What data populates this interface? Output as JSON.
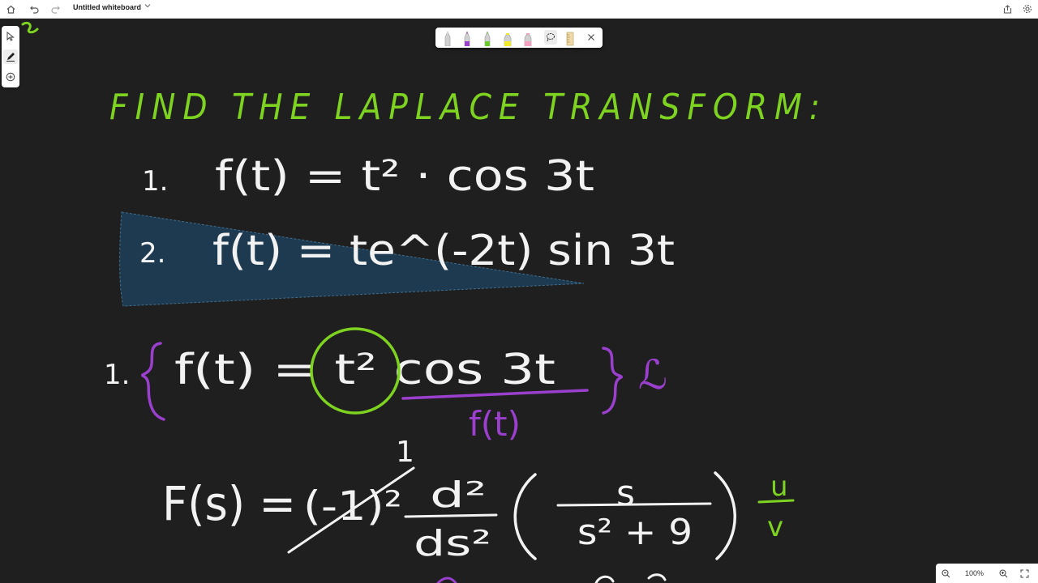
{
  "titlebar": {
    "document_title": "Untitled whiteboard",
    "icons": [
      "home-icon",
      "undo-icon",
      "redo-icon",
      "chevron-down-icon",
      "share-icon",
      "settings-icon"
    ]
  },
  "left_toolbar": {
    "tools": [
      "select-icon",
      "pen-icon",
      "add-icon"
    ]
  },
  "pen_tray": {
    "pens": [
      {
        "name": "pen-white",
        "color": "#e8e8e8"
      },
      {
        "name": "pen-purple",
        "color": "#9b3fcf"
      },
      {
        "name": "pen-green",
        "color": "#6cc92e"
      },
      {
        "name": "highlighter-yellow",
        "color": "#f2ea2c"
      },
      {
        "name": "highlighter-pink",
        "color": "#f4a0c0"
      }
    ],
    "tools": [
      "lasso-icon",
      "ruler-icon",
      "close-icon"
    ]
  },
  "zoom": {
    "level": "100%",
    "icons": [
      "zoom-out-icon",
      "zoom-in-icon",
      "fit-icon"
    ]
  },
  "board": {
    "colors": {
      "background": "#1f1f1f",
      "ink_white": "#f2f2f2",
      "ink_green": "#7ed321",
      "ink_purple": "#9b3fcf",
      "highlight": "#1e3a50"
    },
    "heading": "FIND THE LAPLACE TRANSFORM:",
    "problem1_number": "1.",
    "problem1": "f(t) = t² · cos 3t",
    "problem2_number": "2.",
    "problem2": "f(t) = te^(-2t) sin 3t",
    "solution_number": "1.",
    "solution_expr": "f(t) = t² cos 3t",
    "solution_label": "f(t)",
    "laplace_symbol": "ℒ",
    "Fs_lhs": "F(s) =",
    "Fs_factor": "(-1)²",
    "Fs_factor_result": "1",
    "Fs_derivative_num": "d²",
    "Fs_derivative_den": "ds²",
    "Fs_fraction_num": "s",
    "Fs_fraction_den": "s² + 9",
    "uv_u": "u",
    "uv_v": "v"
  }
}
